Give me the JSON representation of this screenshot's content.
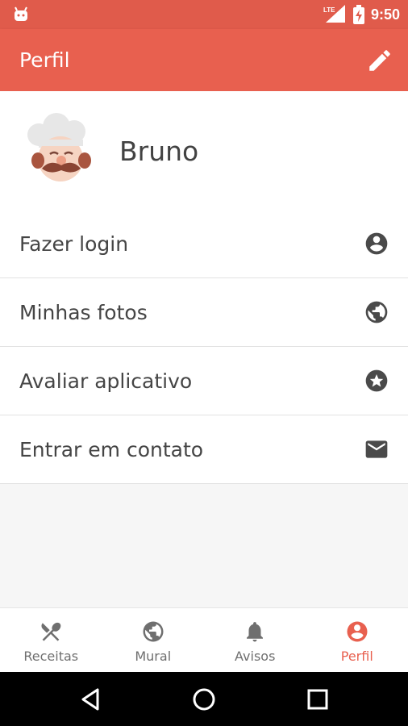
{
  "status_bar": {
    "time": "9:50",
    "network_label": "LTE",
    "icons": [
      "android-icon",
      "signal-icon",
      "battery-charging-icon"
    ]
  },
  "app_bar": {
    "title": "Perfil",
    "action_icon": "edit-icon"
  },
  "profile": {
    "name": "Bruno",
    "avatar_icon": "chef-avatar"
  },
  "menu": [
    {
      "label": "Fazer login",
      "icon": "account-circle-icon"
    },
    {
      "label": "Minhas fotos",
      "icon": "globe-icon"
    },
    {
      "label": "Avaliar aplicativo",
      "icon": "star-circle-icon"
    },
    {
      "label": "Entrar em contato",
      "icon": "mail-icon"
    }
  ],
  "bottom_nav": {
    "active": "Perfil",
    "items": [
      {
        "label": "Receitas",
        "icon": "fork-knife-icon"
      },
      {
        "label": "Mural",
        "icon": "globe-icon"
      },
      {
        "label": "Avisos",
        "icon": "bell-icon"
      },
      {
        "label": "Perfil",
        "icon": "account-circle-icon"
      }
    ]
  },
  "system_nav": [
    "back-icon",
    "home-icon",
    "recents-icon"
  ],
  "colors": {
    "status_bar": "#e05b4b",
    "app_bar": "#e8604f",
    "accent": "#e8604f",
    "text_primary": "#454545",
    "icon": "#4a4a4a",
    "inactive": "#6f6f6f"
  }
}
